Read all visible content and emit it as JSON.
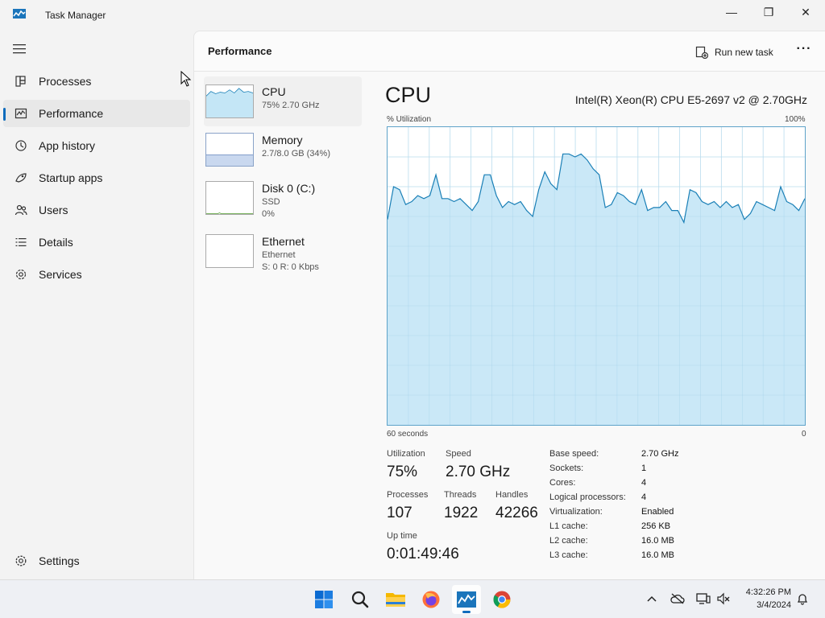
{
  "window": {
    "title": "Task Manager",
    "minimize_glyph": "—",
    "maximize_glyph": "❐",
    "close_glyph": "✕"
  },
  "sidebar": {
    "items": [
      {
        "label": "Processes",
        "icon": "processes-icon"
      },
      {
        "label": "Performance",
        "icon": "performance-icon",
        "active": true
      },
      {
        "label": "App history",
        "icon": "history-icon"
      },
      {
        "label": "Startup apps",
        "icon": "startup-icon"
      },
      {
        "label": "Users",
        "icon": "users-icon"
      },
      {
        "label": "Details",
        "icon": "details-icon"
      },
      {
        "label": "Services",
        "icon": "services-icon"
      }
    ],
    "settings_label": "Settings"
  },
  "header": {
    "title": "Performance",
    "run_new_task": "Run new task",
    "more": "···"
  },
  "devices": [
    {
      "name": "CPU",
      "sub1": "75% 2.70 GHz",
      "sub2": ""
    },
    {
      "name": "Memory",
      "sub1": "2.7/8.0 GB (34%)",
      "sub2": ""
    },
    {
      "name": "Disk 0 (C:)",
      "sub1": "SSD",
      "sub2": "0%"
    },
    {
      "name": "Ethernet",
      "sub1": "Ethernet",
      "sub2": "S: 0 R: 0 Kbps"
    }
  ],
  "detail": {
    "title": "CPU",
    "model": "Intel(R) Xeon(R) CPU E5-2697 v2 @ 2.70GHz",
    "graph_top_left": "% Utilization",
    "graph_top_right": "100%",
    "graph_bottom_left": "60 seconds",
    "graph_bottom_right": "0"
  },
  "chart_data": {
    "type": "area",
    "ylim": [
      0,
      100
    ],
    "x_span_seconds": 60,
    "values": [
      69,
      80,
      79,
      74,
      75,
      77,
      76,
      77,
      84,
      76,
      76,
      75,
      76,
      74,
      72,
      75,
      84,
      84,
      77,
      73,
      75,
      74,
      75,
      72,
      70,
      79,
      85,
      81,
      79,
      91,
      91,
      90,
      91,
      89,
      86,
      84,
      73,
      74,
      78,
      77,
      75,
      74,
      79,
      72,
      73,
      73,
      75,
      72,
      72,
      68,
      79,
      78,
      75,
      74,
      75,
      73,
      75,
      73,
      74,
      69,
      71,
      75,
      74,
      73,
      72,
      80,
      75,
      74,
      72,
      76
    ],
    "color_fill": "#c4e6f6",
    "color_line": "#197fb6"
  },
  "stats": {
    "utilization_label": "Utilization",
    "utilization_value": "75%",
    "speed_label": "Speed",
    "speed_value": "2.70 GHz",
    "processes_label": "Processes",
    "processes_value": "107",
    "threads_label": "Threads",
    "threads_value": "1922",
    "handles_label": "Handles",
    "handles_value": "42266",
    "uptime_label": "Up time",
    "uptime_value": "0:01:49:46"
  },
  "specs": [
    {
      "key": "Base speed:",
      "value": "2.70 GHz"
    },
    {
      "key": "Sockets:",
      "value": "1"
    },
    {
      "key": "Cores:",
      "value": "4"
    },
    {
      "key": "Logical processors:",
      "value": "4"
    },
    {
      "key": "Virtualization:",
      "value": "Enabled"
    },
    {
      "key": "L1 cache:",
      "value": "256 KB"
    },
    {
      "key": "L2 cache:",
      "value": "16.0 MB"
    },
    {
      "key": "L3 cache:",
      "value": "16.0 MB"
    }
  ],
  "taskbar": {
    "apps": [
      "start-icon",
      "search-icon",
      "file-explorer-icon",
      "firefox-icon",
      "task-manager-icon",
      "chrome-icon"
    ],
    "time": "4:32:26 PM",
    "date": "3/4/2024"
  }
}
